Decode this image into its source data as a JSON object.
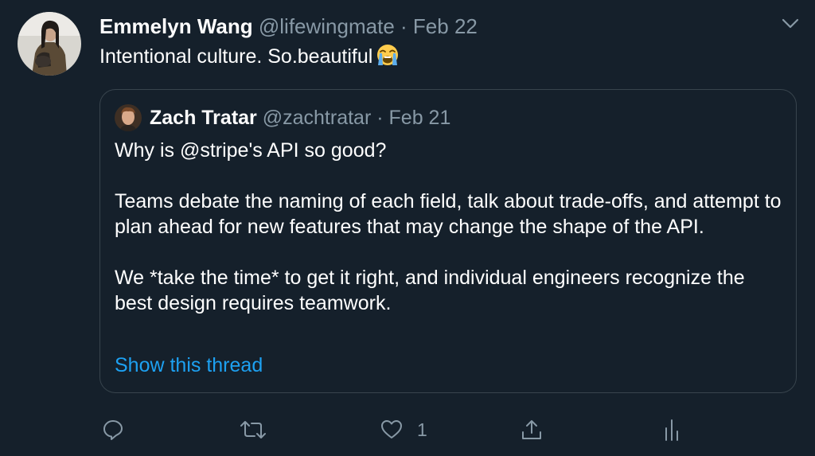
{
  "author": {
    "display_name": "Emmelyn Wang",
    "handle": "@lifewingmate",
    "separator": "·",
    "date": "Feb 22"
  },
  "tweet": {
    "text": "Intentional culture. So.beautiful",
    "emoji": "loudly-crying-face-emoji"
  },
  "quoted": {
    "display_name": "Zach Tratar",
    "handle": "@zachtratar",
    "separator": "·",
    "date": "Feb 21",
    "paragraphs": [
      "Why is @stripe's API so good?",
      "Teams debate the naming of each field, talk about trade-offs, and attempt to plan ahead for new features that may change the shape of the API.",
      "We *take the time* to get it right, and individual engineers recognize the best design requires teamwork."
    ],
    "thread_link": "Show this thread"
  },
  "actions": {
    "reply_icon": "reply-icon",
    "retweet_icon": "retweet-icon",
    "like_icon": "heart-icon",
    "like_count": "1",
    "share_icon": "share-icon",
    "analytics_icon": "analytics-icon"
  },
  "colors": {
    "background": "#15202b",
    "secondary_text": "#8899a6",
    "link": "#1da1f2",
    "border": "#38444d"
  }
}
